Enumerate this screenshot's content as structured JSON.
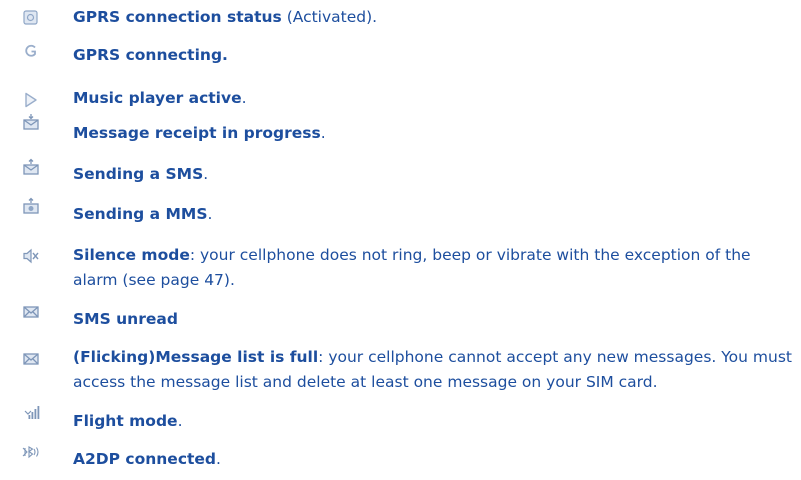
{
  "colors": {
    "text": "#1d4e9e",
    "icon": "#8fa6c6"
  },
  "entries": [
    {
      "icon": "gprs-status-icon",
      "bold": "GPRS connection status",
      "rest": " (Activated)."
    },
    {
      "icon": "gprs-connecting-icon",
      "bold": "GPRS connecting.",
      "rest": ""
    },
    {
      "icon": "music-player-icon",
      "bold": "Music player active",
      "rest": "."
    },
    {
      "icon": "message-receipt-icon",
      "bold": "Message receipt in progress",
      "rest": "."
    },
    {
      "icon": "sending-sms-icon",
      "bold": "Sending a SMS",
      "rest": "."
    },
    {
      "icon": "sending-mms-icon",
      "bold": "Sending a MMS",
      "rest": "."
    },
    {
      "icon": "silence-mode-icon",
      "bold": "Silence mode",
      "rest": ": your cellphone does not ring, beep or vibrate with the exception of the alarm (see page 47)."
    },
    {
      "icon": "sms-unread-icon",
      "bold": "SMS unread",
      "rest": ""
    },
    {
      "icon": "message-list-full-icon",
      "bold": "(Flicking)Message list is full",
      "rest": ": your cellphone cannot accept any new messages. You must access the message list and delete at least one message on your SIM card."
    },
    {
      "icon": "flight-mode-icon",
      "bold": "Flight mode",
      "rest": "."
    },
    {
      "icon": "a2dp-connected-icon",
      "bold": "A2DP connected",
      "rest": "."
    }
  ]
}
